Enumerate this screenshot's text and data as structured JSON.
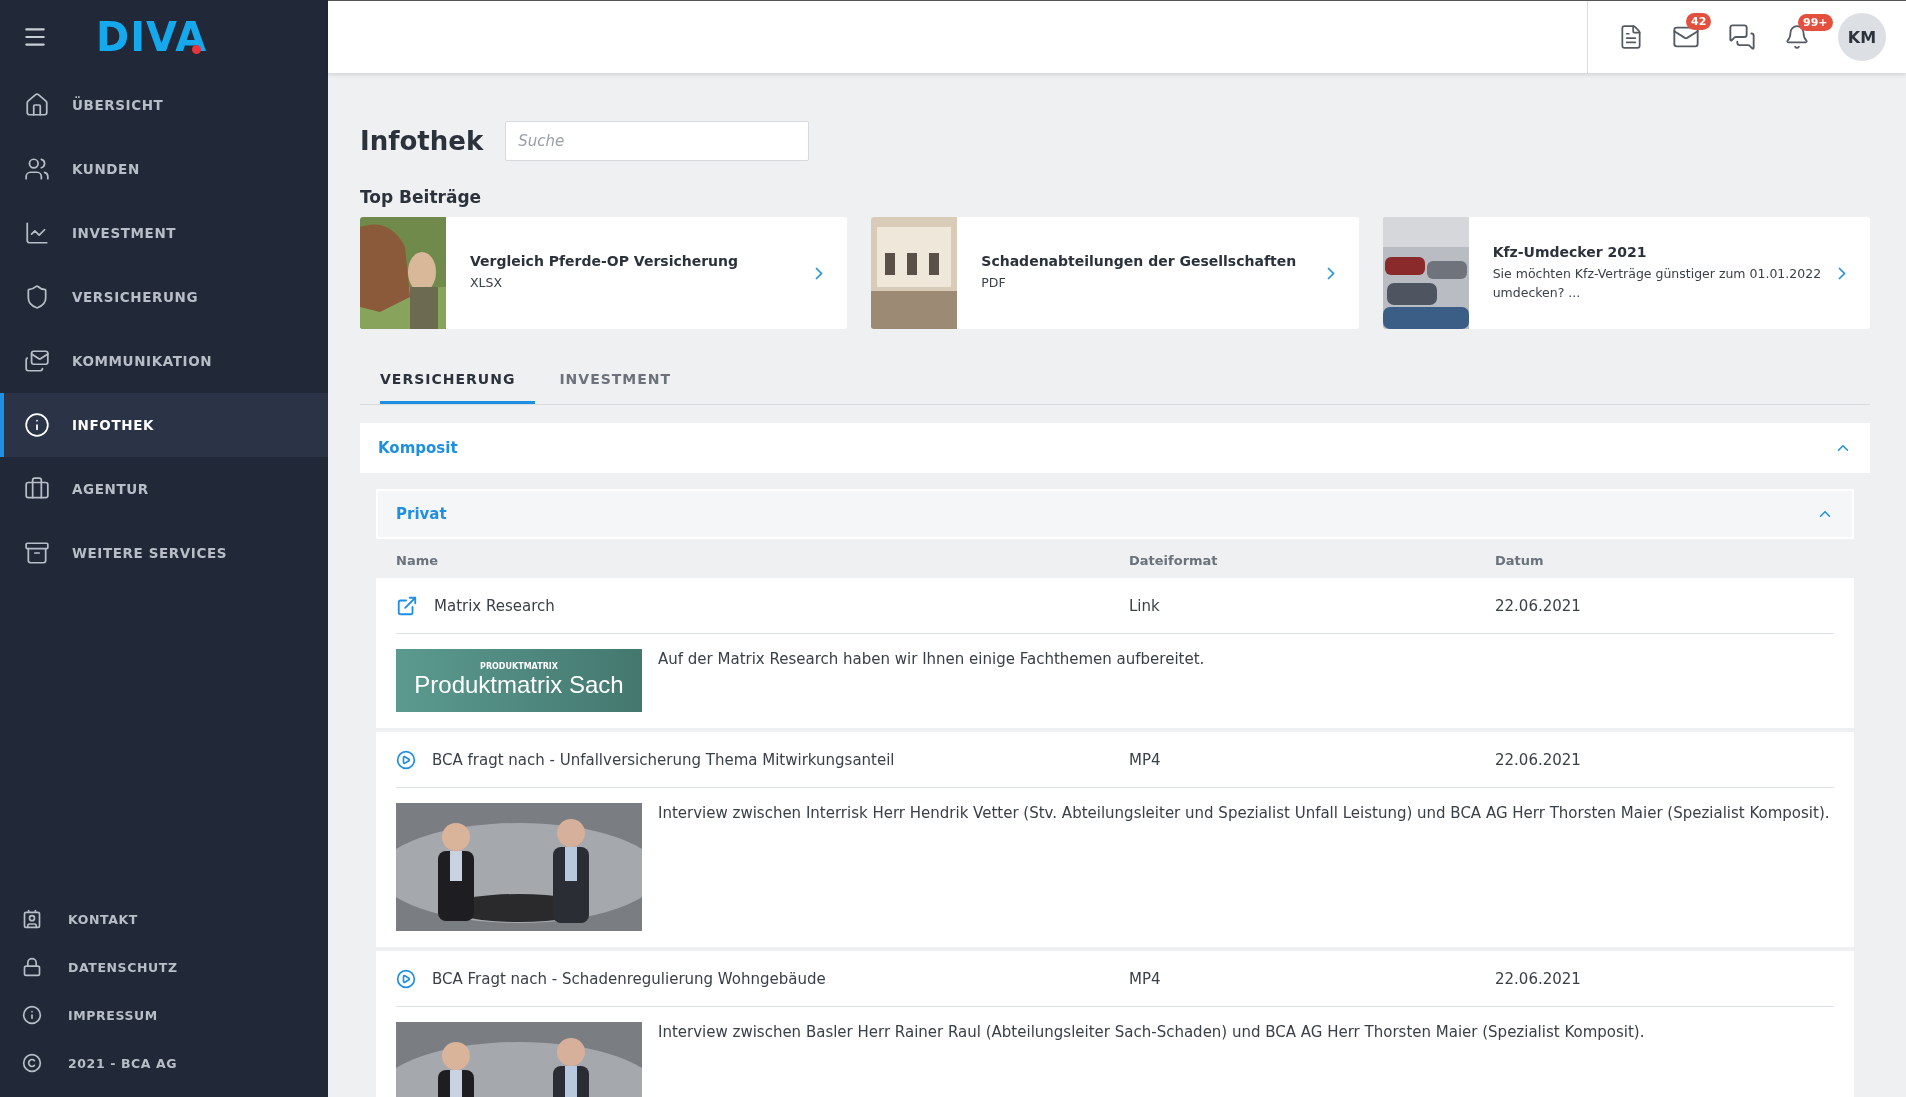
{
  "sidebar": {
    "logo": "DIVA",
    "items": [
      {
        "label": "ÜBERSICHT",
        "selected": false
      },
      {
        "label": "KUNDEN",
        "selected": false
      },
      {
        "label": "INVESTMENT",
        "selected": false
      },
      {
        "label": "VERSICHERUNG",
        "selected": false
      },
      {
        "label": "KOMMUNIKATION",
        "selected": false
      },
      {
        "label": "INFOTHEK",
        "selected": true
      },
      {
        "label": "AGENTUR",
        "selected": false
      },
      {
        "label": "WEITERE SERVICES",
        "selected": false
      }
    ],
    "footer_items": [
      "KONTAKT",
      "DATENSCHUTZ",
      "IMPRESSUM",
      "2021 - BCA AG"
    ]
  },
  "header": {
    "mail_badge": "42",
    "notification_badge": "99+",
    "avatar": "KM"
  },
  "page": {
    "title": "Infothek",
    "search": {
      "placeholder": "Suche"
    }
  },
  "top_posts": {
    "title": "Top Beiträge",
    "cards": [
      {
        "title": "Vergleich Pferde-OP Versicherung",
        "subtitle": "XLSX"
      },
      {
        "title": "Schadenabteilungen der Gesellschaften",
        "subtitle": "PDF"
      },
      {
        "title": "Kfz-Umdecker 2021",
        "subtitle": "Sie möchten Kfz-Verträge günstiger zum 01.01.2022 umdecken? ..."
      }
    ]
  },
  "tabs": [
    {
      "label": "VERSICHERUNG",
      "selected": true
    },
    {
      "label": "INVESTMENT",
      "selected": false
    }
  ],
  "section": {
    "title": "Komposit",
    "expanded": true,
    "subsection": {
      "title": "Privat",
      "expanded": true,
      "columns": [
        "Name",
        "Dateiformat",
        "Datum"
      ],
      "rows": [
        {
          "kind": "link",
          "name": "Matrix Research",
          "format": "Link",
          "date": "22.06.2021",
          "description": "Auf der Matrix Research haben wir Ihnen einige Fachthemen aufbereitet.",
          "thumbnail": {
            "kind": "banner",
            "caption": "PRODUKTMATRIX",
            "title": "Produktmatrix Sach"
          }
        },
        {
          "kind": "video",
          "name": "BCA fragt nach - Unfallversicherung Thema Mitwirkungsanteil",
          "format": "MP4",
          "date": "22.06.2021",
          "description": "Interview zwischen Interrisk Herr Hendrik Vetter (Stv. Abteilungsleiter und Spezialist Unfall Leistung) und BCA AG Herr Thorsten Maier (Spezialist Komposit)."
        },
        {
          "kind": "video",
          "name": "BCA Fragt nach - Schadenregulierung Wohngebäude",
          "format": "MP4",
          "date": "22.06.2021",
          "description": "Interview zwischen Basler Herr Rainer Raul (Abteilungsleiter Sach-Schaden) und BCA AG Herr Thorsten Maier (Spezialist Komposit)."
        }
      ]
    }
  }
}
